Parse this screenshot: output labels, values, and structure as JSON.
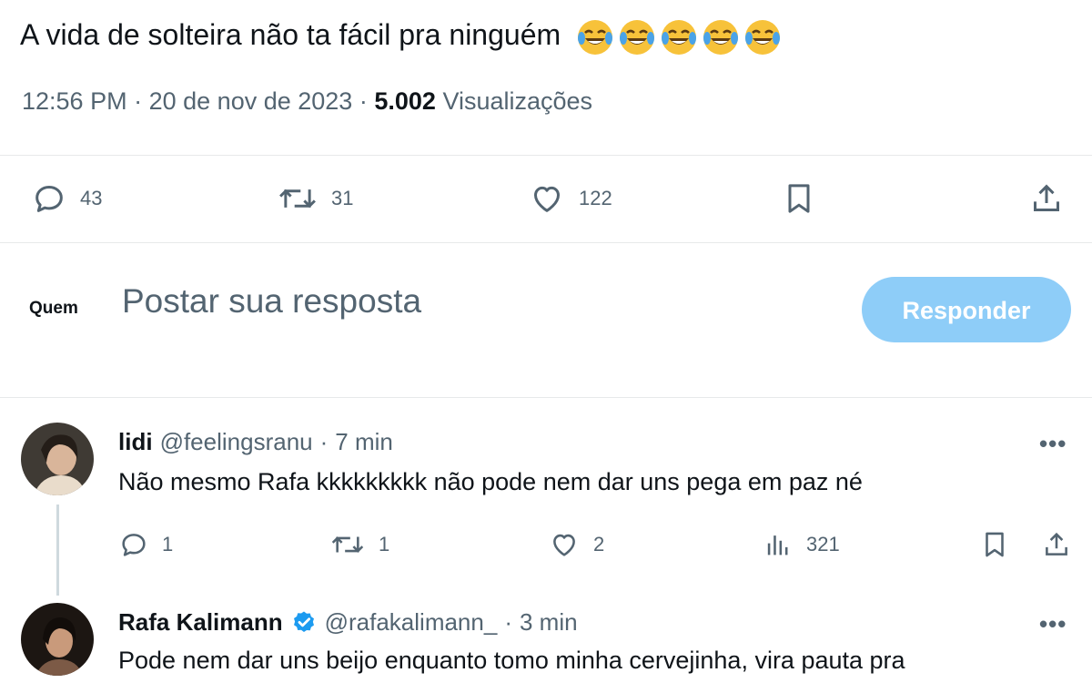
{
  "tweet": {
    "text": "A vida de solteira não ta fácil pra ninguém",
    "emojis": [
      "face-with-tears-of-joy",
      "face-with-tears-of-joy",
      "face-with-tears-of-joy",
      "face-with-tears-of-joy",
      "face-with-tears-of-joy"
    ],
    "time": "12:56 PM",
    "separator": "·",
    "date": "20 de nov de 2023",
    "views_count": "5.002",
    "views_label": "Visualizações"
  },
  "actions": {
    "reply": {
      "icon": "comment-icon",
      "count": "43"
    },
    "retweet": {
      "icon": "retweet-icon",
      "count": "31"
    },
    "like": {
      "icon": "heart-icon",
      "count": "122"
    },
    "bookmark": {
      "icon": "bookmark-icon"
    },
    "share": {
      "icon": "share-icon"
    }
  },
  "compose": {
    "avatar_label": "Quem",
    "placeholder": "Postar sua resposta",
    "button_label": "Responder"
  },
  "replies": [
    {
      "name": "lidi",
      "handle": "@feelingsranu",
      "separator": "·",
      "time": "7 min",
      "text": "Não mesmo Rafa kkkkkkkkk não pode nem dar uns pega em paz né",
      "more": "•••",
      "reply_count": "1",
      "retweet_count": "1",
      "like_count": "2",
      "views_count": "321"
    },
    {
      "name": "Rafa Kalimann",
      "verified": true,
      "handle": "@rafakalimann_",
      "separator": "·",
      "time": "3 min",
      "text": "Pode nem dar uns beijo enquanto tomo minha cervejinha, vira pauta pra",
      "more": "•••"
    }
  ],
  "colors": {
    "text_primary": "#0f1419",
    "text_secondary": "#536471",
    "button_disabled": "#8ecdf8",
    "verified": "#1d9bf0",
    "divider": "#e7e9ea"
  }
}
